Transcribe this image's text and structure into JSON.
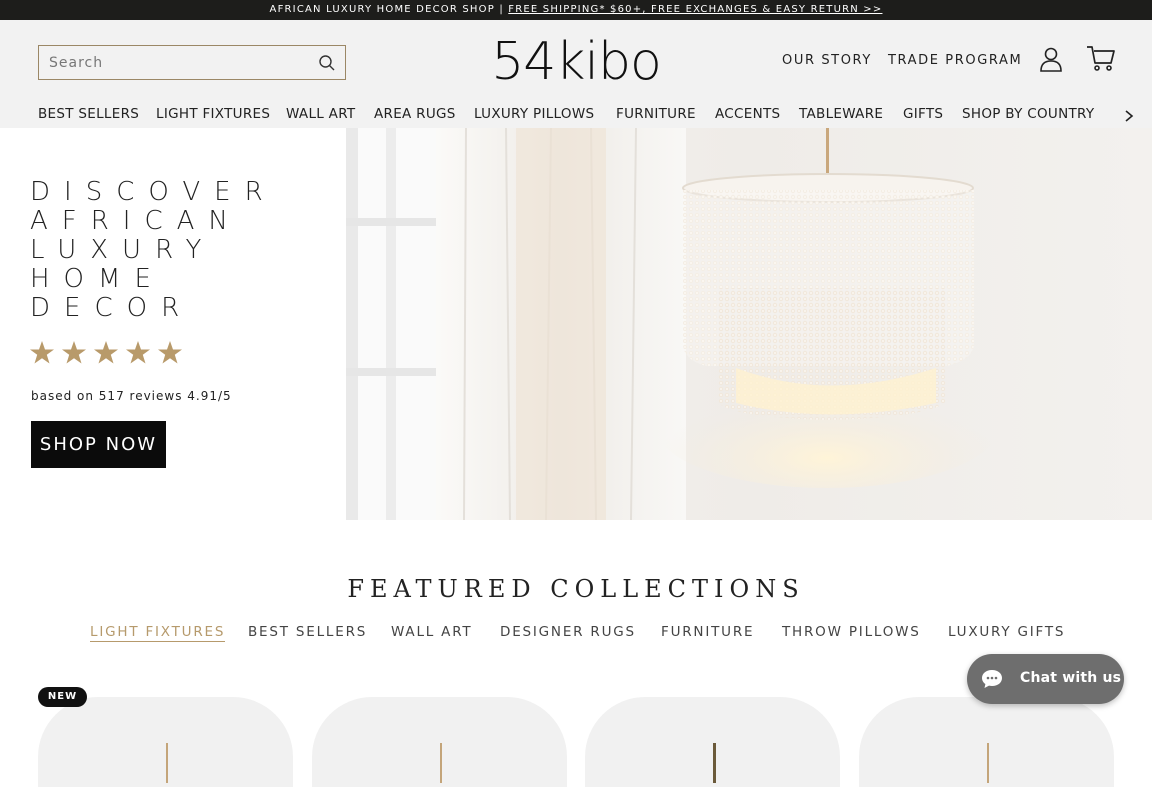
{
  "announcement": {
    "prefix": "AFRICAN LUXURY HOME DECOR SHOP | ",
    "link": "FREE SHIPPING* $60+, FREE EXCHANGES & EASY RETURN >>"
  },
  "header": {
    "search_placeholder": "Search",
    "logo": "54kibo",
    "our_story": "OUR STORY",
    "trade_program": "TRADE PROGRAM"
  },
  "nav": {
    "items": [
      "BEST SELLERS",
      "LIGHT FIXTURES",
      "WALL ART",
      "AREA RUGS",
      "LUXURY PILLOWS",
      "FURNITURE",
      "ACCENTS",
      "TABLEWARE",
      "GIFTS",
      "SHOP BY COUNTRY"
    ]
  },
  "hero": {
    "title": "DISCOVER\nAFRICAN\nLUXURY\nHOME\nDECOR",
    "rating_stars": 5,
    "reviews": "based on 517 reviews 4.91/5",
    "cta": "SHOP NOW"
  },
  "featured": {
    "heading": "FEATURED COLLECTIONS",
    "tabs": [
      "LIGHT FIXTURES",
      "BEST SELLERS",
      "WALL ART",
      "DESIGNER RUGS",
      "FURNITURE",
      "THROW PILLOWS",
      "LUXURY GIFTS"
    ],
    "active_tab": "LIGHT FIXTURES",
    "badge": "NEW"
  },
  "chat": {
    "label": "Chat with us"
  },
  "colors": {
    "accent_gold": "#b69a6c",
    "star_gold": "#b89a6a",
    "header_bg": "#f2f2f2",
    "announce_bg": "#1d1d1b"
  }
}
